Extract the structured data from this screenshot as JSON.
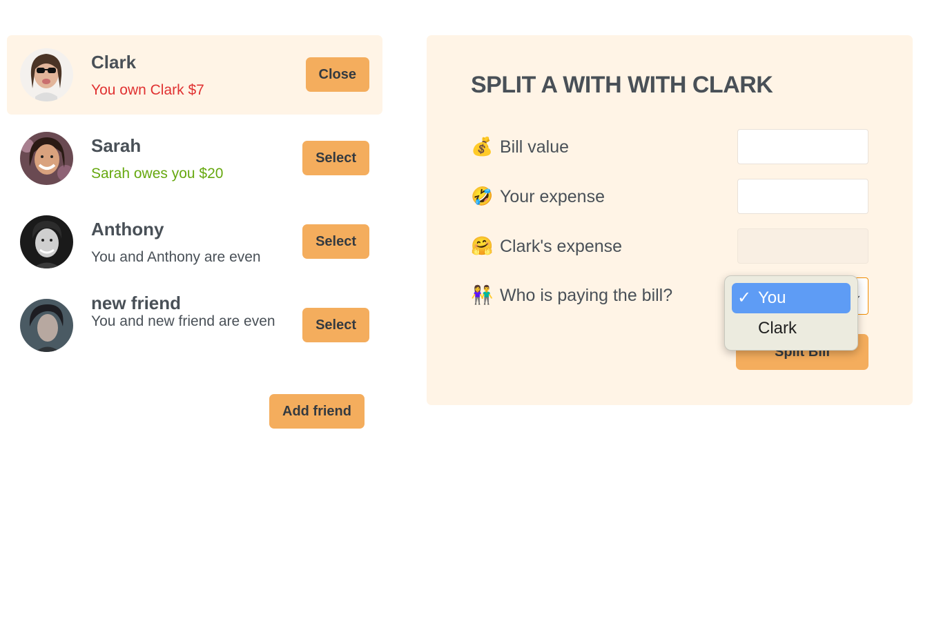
{
  "friends": [
    {
      "name": "Clark",
      "status": "You own Clark $7",
      "status_type": "red",
      "button": "Close",
      "selected": true
    },
    {
      "name": "Sarah",
      "status": "Sarah owes you $20",
      "status_type": "green",
      "button": "Select",
      "selected": false
    },
    {
      "name": "Anthony",
      "status": "You and Anthony are even",
      "status_type": "neutral",
      "button": "Select",
      "selected": false
    },
    {
      "name": "new friend",
      "status": "You and new friend are even",
      "status_type": "neutral",
      "button": "Select",
      "selected": false
    }
  ],
  "add_friend_label": "Add friend",
  "form": {
    "title": "SPLIT A WITH WITH CLARK",
    "rows": [
      {
        "emoji": "💰",
        "label": "Bill value",
        "value": ""
      },
      {
        "emoji": "🤣",
        "label": "Your expense",
        "value": ""
      },
      {
        "emoji": "🤗",
        "label": "Clark's expense",
        "value": ""
      },
      {
        "emoji": "👫",
        "label": "Who is paying the bill?"
      }
    ],
    "select_options": [
      "You",
      "Clark"
    ],
    "selected_option": "You",
    "submit_label": "Split Bill"
  },
  "colors": {
    "accent": "#f4ad5d",
    "panel_bg": "#fff4e6",
    "debt_red": "#e03131",
    "credit_green": "#66a80f",
    "highlight_blue": "#5e9cf5"
  },
  "icons": {
    "check": "✓",
    "select_arrow": "chevron-down-icon"
  }
}
